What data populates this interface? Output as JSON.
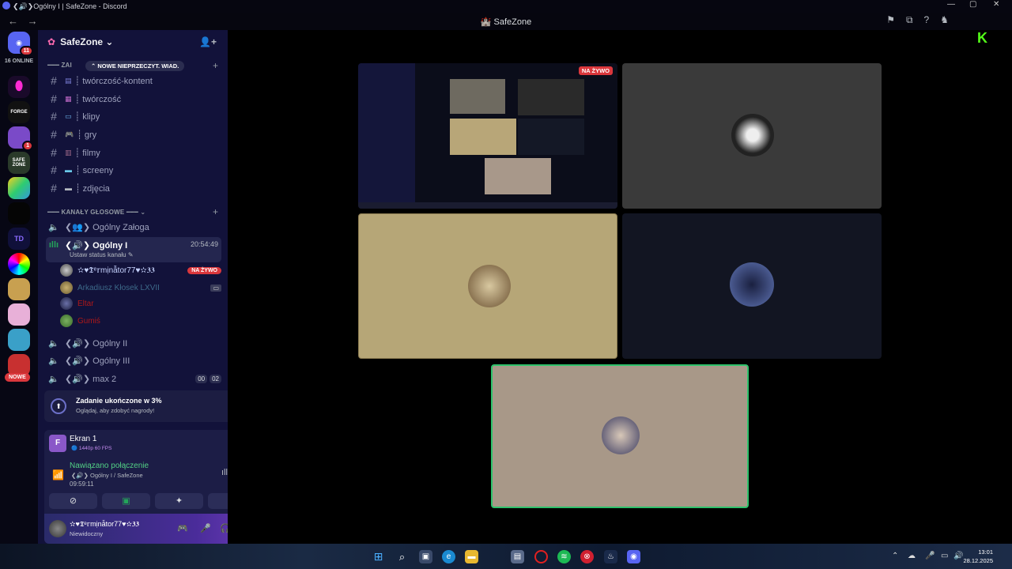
{
  "window": {
    "title": "❮🔊❯Ogólny I | SafeZone - Discord",
    "min": "—",
    "max": "▢",
    "close": "✕"
  },
  "topbar": {
    "back": "←",
    "forward": "→",
    "title": "🏰 SafeZone"
  },
  "servers": {
    "online_label": "16 ONLINE",
    "home_badge": "11",
    "badge_1": "1",
    "badge_2": "1",
    "nowe_label": "NOWE"
  },
  "sidebar": {
    "server_name": "SafeZone ⌄",
    "new_unread_pill": "⌃ NOWE NIEPRZECZYT. WIAD.",
    "text_category": "━━━ ZAI",
    "text_channels": [
      {
        "name": "┊ twórczość-kontent"
      },
      {
        "name": "┊ twórczość"
      },
      {
        "name": "┊ klipy"
      },
      {
        "name": "┊ gry"
      },
      {
        "name": "┊ filmy"
      },
      {
        "name": "┊ screeny"
      },
      {
        "name": "┊ zdjęcia"
      }
    ],
    "voice_category": "━━━ KANAŁY GŁOSOWE ━━━ ⌄",
    "voice_top": "❮👥❯ Ogólny Załoga",
    "active_voice": {
      "name": "❮🔊❯ Ogólny I",
      "time": "20:54:49",
      "status": "Ustaw status kanału ✎"
    },
    "members": [
      {
        "name": "✫♥𝕿ᵉ𝕣mịnẫtor77♥✫𝟑𝟑",
        "color": "#c7d4ff",
        "badge": "NA ŻYWO"
      },
      {
        "name": "Arkadiusz Kłosek LXVII",
        "color": "#3d6a8a",
        "badge": ""
      },
      {
        "name": "Eltar",
        "color": "#b01818",
        "badge": ""
      },
      {
        "name": "Gumiś",
        "color": "#b01818",
        "badge": ""
      }
    ],
    "voice_channels": [
      {
        "name": "❮🔊❯ Ogólny II"
      },
      {
        "name": "❮🔊❯ Ogólny III"
      },
      {
        "name": "❮🔊❯ max 2",
        "count_a": "00",
        "count_b": "02"
      }
    ]
  },
  "quest": {
    "title": "Zadanie ukończone w 3%",
    "subtitle": "Oglądaj, aby zdobyć nagrody!"
  },
  "screen_share": {
    "icon_letter": "F",
    "name": "Ekran 1",
    "quality": "🔵 1440p 60 FPS"
  },
  "connection": {
    "status": "Nawiązano połączenie",
    "channel": "❮🔊❯ Ogólny I / SafeZone",
    "time": "09:59:11"
  },
  "user": {
    "name": "✫♥𝕿ᵉ𝕣mịnẫtor77♥✫𝟑𝟑",
    "status": "Niewidoczny"
  },
  "stage": {
    "live_badge": "NA ŻYWO"
  },
  "taskbar": {
    "date": "28.12.2025",
    "time": "13:01"
  },
  "colors": {
    "accent": "#5865f2",
    "live": "#da373c",
    "green": "#23a55a",
    "sidebar": "#12123a"
  }
}
